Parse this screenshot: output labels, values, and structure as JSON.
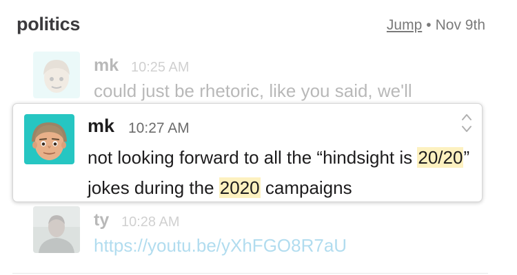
{
  "channel": {
    "name": "politics",
    "jump_label": "Jump",
    "separator": "•",
    "date": "Nov 9th"
  },
  "messages": [
    {
      "author": "mk",
      "time": "10:25 AM",
      "text": "could just be rhetoric, like you said, we'll"
    },
    {
      "author": "mk",
      "time": "10:27 AM",
      "text_parts": [
        "not looking forward to all the “hindsight is ",
        "20/20",
        "” jokes during the ",
        "2020",
        " campaigns"
      ]
    },
    {
      "author": "ty",
      "time": "10:28 AM",
      "text": "https://youtu.be/yXhFGO8R7aU"
    }
  ],
  "colors": {
    "highlight": "#fdf1c0",
    "avatar_mk_bg": "#26c6c2",
    "link": "#1d9bd1"
  },
  "icons": {
    "avatar_mk": "bitmoji-avatar-icon",
    "avatar_ty": "user-photo-icon",
    "card_arrows": "chevron-up-down-icon"
  }
}
